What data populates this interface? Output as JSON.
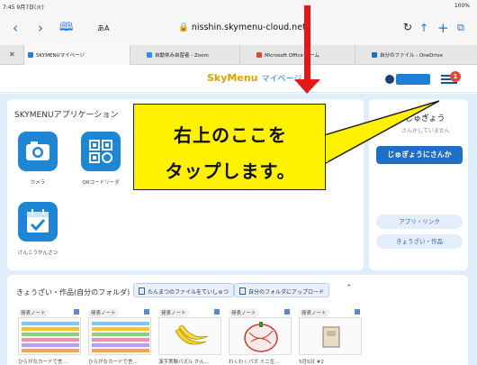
{
  "status_bar": {
    "time": "7:45 9月7日(火)",
    "battery": "100%"
  },
  "browser": {
    "aa_label": "あA",
    "url": "nisshin.skymenu-cloud.net",
    "reload_icon": "reload-icon",
    "tabs": [
      {
        "label": "SKYMENUマイページ",
        "active": true,
        "dot_color": "#1f7fd8"
      },
      {
        "label": "自動休み自習者 - Zoom",
        "active": false,
        "dot_color": "#2d8cff"
      },
      {
        "label": "Microsoft Office ホーム",
        "active": false,
        "dot_color": "#e0492c"
      },
      {
        "label": "自分のファイル - OneDrive",
        "active": false,
        "dot_color": "#1870cc"
      }
    ]
  },
  "header": {
    "logo": "SkyMenu",
    "mypage": "マイページ",
    "badge_count": "1"
  },
  "apps": {
    "title": "SKYMENUアプリケーション",
    "items": [
      {
        "label": "カメラ",
        "icon": "camera-icon"
      },
      {
        "label": "QRコードリーダ",
        "icon": "qr-code-icon"
      },
      {
        "label": "けんこうかんさつ",
        "icon": "calendar-check-icon"
      }
    ]
  },
  "side": {
    "title": "じゅぎょう",
    "subtitle": "さんかしていません",
    "join_button": "じゅぎょうにさんか",
    "links": [
      "アプリ・リンク",
      "きょうざい・作品"
    ]
  },
  "works": {
    "title": "きょうざい・作品(自分のフォルダ)",
    "btn_temporary": "たんまつのファイルをていしゅつ",
    "btn_upload": "自分のフォルダにアップロード",
    "cards": [
      {
        "tag": "発表ノート",
        "caption": "ひらがなカードで言…",
        "thumb": "grid"
      },
      {
        "tag": "発表ノート",
        "caption": "ひらがなカードで言…",
        "thumb": "grid"
      },
      {
        "tag": "発表ノート",
        "caption": "漢字実験パズル かん…",
        "thumb": "banana"
      },
      {
        "tag": "発表ノート",
        "caption": "わくわくパズ ミニ生…",
        "thumb": "drawing"
      },
      {
        "tag": "発表ノート",
        "caption": "5月5日 #2",
        "thumb": "box"
      }
    ]
  },
  "callout": {
    "line1": "右上のここを",
    "line2": "タップします。"
  },
  "colors": {
    "accent": "#1f7fd8",
    "callout": "#fff100",
    "arrow": "#e0191b",
    "badge": "#e8453c"
  }
}
